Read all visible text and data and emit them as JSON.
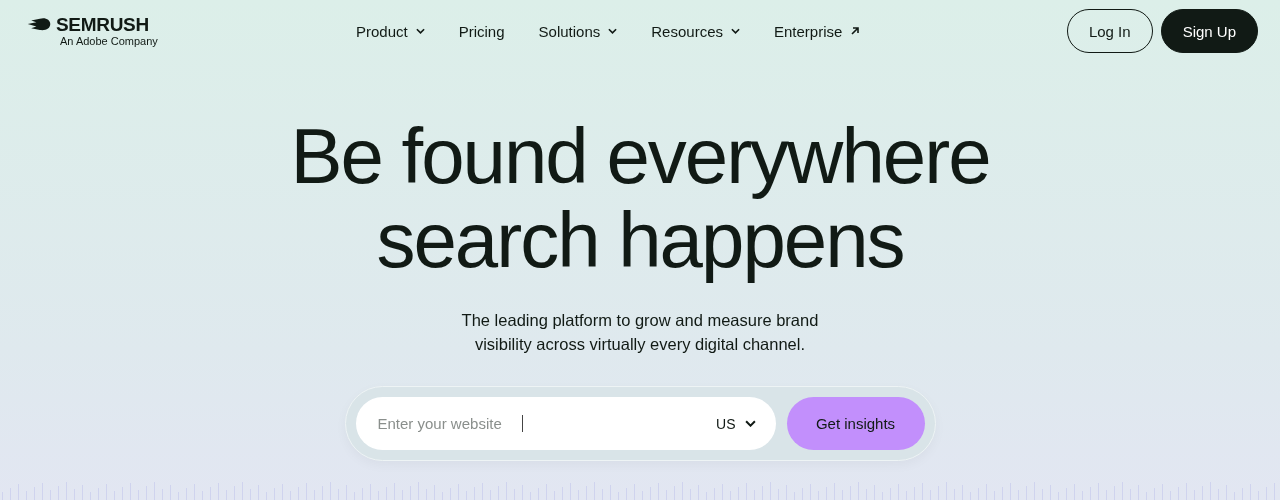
{
  "logo": {
    "name": "SEMRUSH",
    "tagline": "An Adobe Company"
  },
  "nav": [
    {
      "label": "Product",
      "kind": "dropdown"
    },
    {
      "label": "Pricing",
      "kind": "link"
    },
    {
      "label": "Solutions",
      "kind": "dropdown"
    },
    {
      "label": "Resources",
      "kind": "dropdown"
    },
    {
      "label": "Enterprise",
      "kind": "external"
    }
  ],
  "auth": {
    "login": "Log In",
    "signup": "Sign Up"
  },
  "hero": {
    "headline": [
      "Be found everywhere",
      "search happens"
    ],
    "subtitle": [
      "The leading platform to grow and measure brand",
      "visibility across virtually every digital channel."
    ]
  },
  "search": {
    "placeholder": "Enter your website",
    "country": "US",
    "button": "Get insights"
  }
}
